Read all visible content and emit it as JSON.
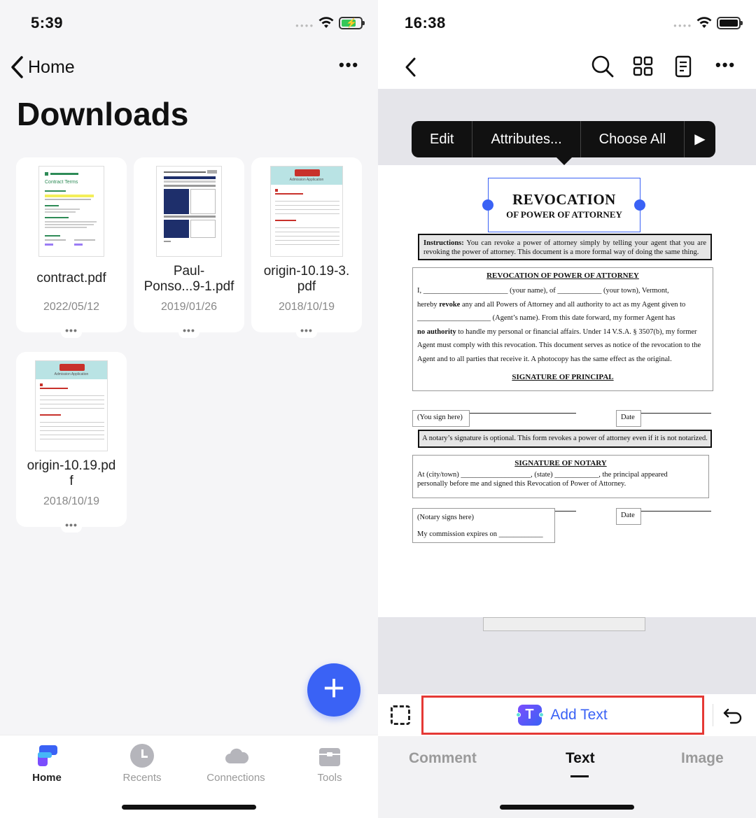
{
  "left": {
    "status": {
      "time": "5:39"
    },
    "nav": {
      "back_label": "Home"
    },
    "title": "Downloads",
    "files": [
      {
        "name": "contract.pdf",
        "date": "2022/05/12",
        "thumb": "contract"
      },
      {
        "name": "Paul-\nPonso...9-1.pdf",
        "date": "2019/01/26",
        "thumb": "form"
      },
      {
        "name": "origin-10.19-3.\npdf",
        "date": "2018/10/19",
        "thumb": "admission"
      },
      {
        "name": "origin-10.19.pd\nf",
        "date": "2018/10/19",
        "thumb": "admission"
      }
    ],
    "thumb_text": {
      "contract_heading": "Contract Terms",
      "admission_header": "Admission Application"
    },
    "tabs": [
      {
        "label": "Home",
        "icon": "home-icon",
        "active": true
      },
      {
        "label": "Recents",
        "icon": "clock-icon",
        "active": false
      },
      {
        "label": "Connections",
        "icon": "cloud-icon",
        "active": false
      },
      {
        "label": "Tools",
        "icon": "toolbox-icon",
        "active": false
      }
    ],
    "colors": {
      "accent": "#3a62f5",
      "battery_charging": "#34c759"
    }
  },
  "right": {
    "status": {
      "time": "16:38"
    },
    "context_menu": {
      "edit": "Edit",
      "attributes": "Attributes...",
      "choose_all": "Choose All",
      "more": "▶"
    },
    "doc": {
      "title": "REVOCATION",
      "subtitle": "OF POWER OF ATTORNEY",
      "instructions_bold": "Instructions:",
      "instructions": " You can revoke a power of attorney simply by telling your agent that you are revoking the power of attorney.  This document is a more formal way of doing the same thing.",
      "section1_title": "REVOCATION OF POWER OF ATTORNEY",
      "p1": "I, _______________________ (your name), of ____________ (your town), Vermont,",
      "p2a": "hereby ",
      "p2b": "revoke",
      "p2c": " any and all Powers of Attorney and all authority to act as my Agent given to",
      "p3": "____________________ (Agent’s name).  From this date forward, my former Agent has",
      "p4a": "no authority",
      "p4b": " to handle my personal or financial affairs.  Under 14 V.S.A. § 3507(b), my former",
      "p5": "Agent must comply with this revocation. This document serves as notice of the revocation to the",
      "p6": "Agent and to all parties that receive it.  A photocopy has the same effect as the original.",
      "sig_principal": "SIGNATURE OF PRINCIPAL",
      "you_sign": "(You sign here)",
      "date1": "Date",
      "notary_note": "A notary’s signature is optional.  This form revokes a power of attorney even if it is not notarized.",
      "sig_notary": "SIGNATURE OF NOTARY",
      "notary_p1": "At (city/town) ___________________, (state) ____________, the principal appeared",
      "notary_p2": "personally before me and signed this Revocation of Power of Attorney.",
      "notary_signs": "(Notary signs here)",
      "date2": "Date",
      "commission": "My commission expires on ____________"
    },
    "tool": {
      "add_text": "Add Text"
    },
    "modes": [
      {
        "label": "Comment",
        "active": false
      },
      {
        "label": "Text",
        "active": true
      },
      {
        "label": "Image",
        "active": false
      }
    ],
    "colors": {
      "highlight_border": "#e53935"
    }
  }
}
